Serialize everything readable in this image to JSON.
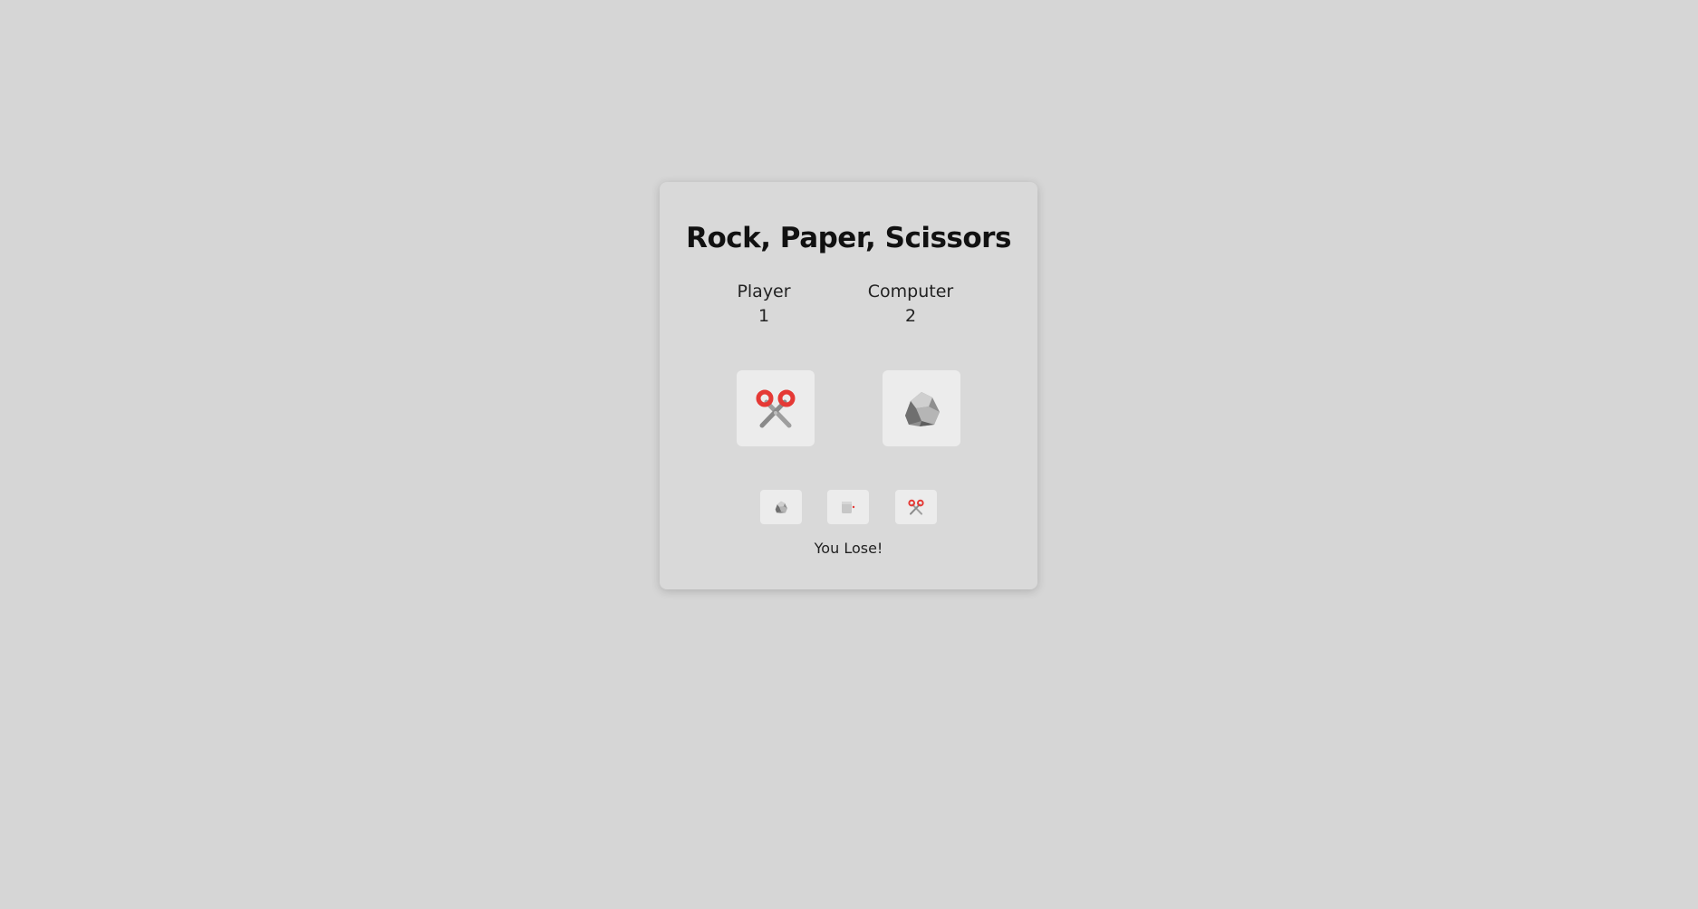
{
  "game": {
    "title": "Rock, Paper, Scissors",
    "player": {
      "label": "Player",
      "score": "1",
      "choice_icon": "scissors-icon"
    },
    "computer": {
      "label": "Computer",
      "score": "2",
      "choice_icon": "rock-icon"
    },
    "choices": [
      {
        "name": "rock",
        "icon": "rock-icon"
      },
      {
        "name": "paper",
        "icon": "paper-icon"
      },
      {
        "name": "scissors",
        "icon": "scissors-icon"
      }
    ],
    "result": "You Lose!"
  },
  "colors": {
    "background": "#d6d6d6",
    "card": "#d9d9d9",
    "tile": "#ececec",
    "scissors_red": "#e53935"
  }
}
